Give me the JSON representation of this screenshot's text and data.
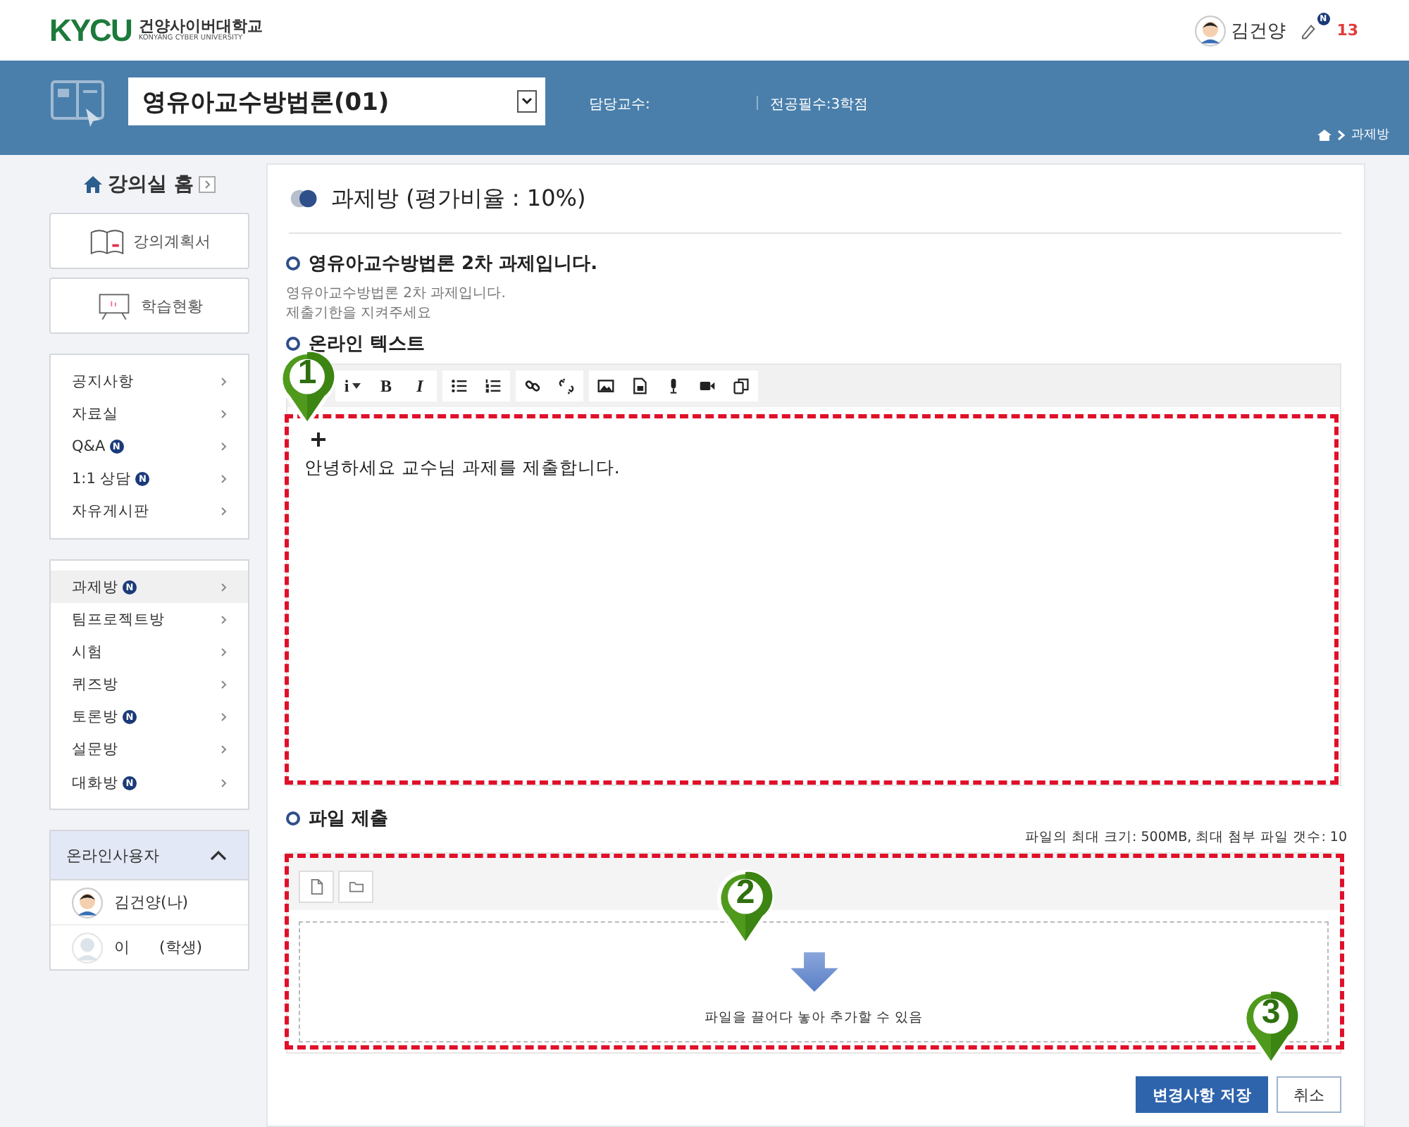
{
  "header": {
    "logo": {
      "mark": "KYCU",
      "name": "건양사이버대학교",
      "sub": "KONYANG CYBER UNIVERSITY"
    },
    "user": "김건양",
    "notif_badge": "N",
    "notif_count": "13"
  },
  "course_bar": {
    "course": "영유아교수방법론(01)",
    "professor": "담당교수:",
    "credit": "전공필수:3학점",
    "breadcrumb": "과제방"
  },
  "sidebar": {
    "home": "강의실 홈",
    "buttons": [
      {
        "label": "강의계획서",
        "kind": "book"
      },
      {
        "label": "학습현황",
        "kind": "board"
      }
    ],
    "menus": [
      {
        "items": [
          {
            "label": "공지사항",
            "selected": false
          },
          {
            "label": "자료실",
            "selected": false
          },
          {
            "label": "Q&A",
            "badge": "N",
            "selected": false
          },
          {
            "label": "1:1 상담",
            "badge": "N",
            "selected": false
          },
          {
            "label": "자유게시판",
            "selected": false
          }
        ]
      },
      {
        "items": [
          {
            "label": "과제방",
            "badge": "N",
            "selected": true
          },
          {
            "label": "팀프로젝트방",
            "selected": false
          },
          {
            "label": "시험",
            "selected": false
          },
          {
            "label": "퀴즈방",
            "selected": false
          },
          {
            "label": "토론방",
            "badge": "N",
            "selected": false
          },
          {
            "label": "설문방",
            "selected": false
          },
          {
            "label": "대화방",
            "badge": "N",
            "selected": false
          }
        ]
      }
    ],
    "online": {
      "title": "온라인사용자",
      "expanded": true,
      "users": [
        {
          "name": "김건양(나)",
          "kind": "me"
        },
        {
          "name": "이      (학생)",
          "kind": "other"
        }
      ]
    }
  },
  "main": {
    "title": "과제방 (평가비율 : 10%)",
    "assignment": {
      "heading": "영유아교수방법론 2차 과제입니다.",
      "lines": [
        "영유아교수방법론 2차 과제입니다.",
        "제출기한을 지켜주세요"
      ]
    },
    "online_text": {
      "label": "온라인 텍스트",
      "toolbar_groups": [
        {
          "items": [
            {
              "kind": "dropdown",
              "label": "i"
            },
            {
              "kind": "bold",
              "label": "B"
            },
            {
              "kind": "italic",
              "label": "I"
            }
          ]
        },
        {
          "items": [
            {
              "kind": "bullets"
            },
            {
              "kind": "numbers"
            }
          ]
        },
        {
          "items": [
            {
              "kind": "link"
            },
            {
              "kind": "unlink"
            }
          ]
        },
        {
          "items": [
            {
              "kind": "image"
            },
            {
              "kind": "media"
            },
            {
              "kind": "mic"
            },
            {
              "kind": "video"
            },
            {
              "kind": "paste"
            }
          ]
        }
      ],
      "content": "안녕하세요 교수님 과제를 제출합니다."
    },
    "file": {
      "label": "파일 제출",
      "limit": "파일의 최대 크기: 500MB, 최대 첨부 파일 갯수: 10",
      "drop_hint": "파일을 끌어다 놓아 추가할 수 있음"
    },
    "buttons": {
      "save": "변경사항 저장",
      "cancel": "취소"
    }
  },
  "annotations": [
    "1",
    "2",
    "3"
  ]
}
